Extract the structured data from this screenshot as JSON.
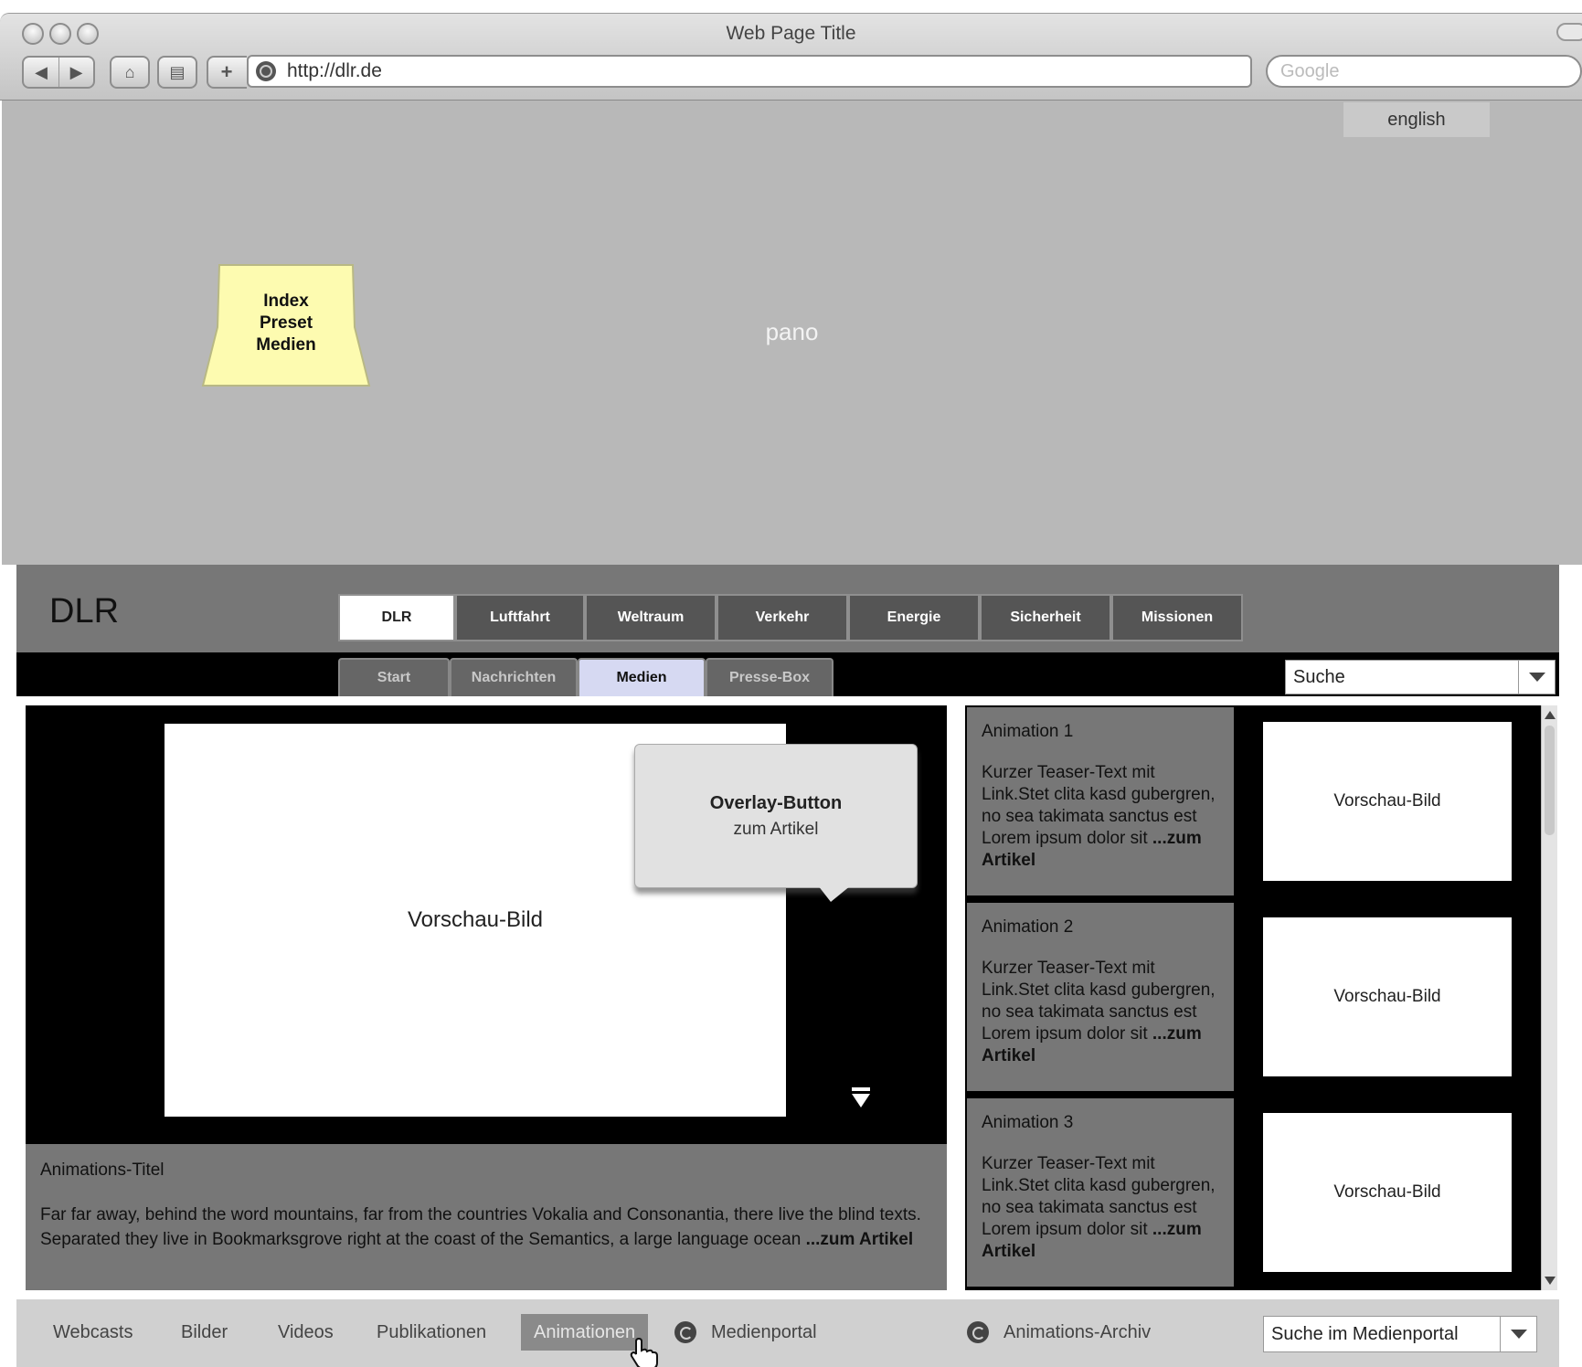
{
  "browser": {
    "window_title": "Web Page Title",
    "url": "http://dlr.de",
    "search_placeholder": "Google"
  },
  "header": {
    "language_label": "english",
    "pano_label": "pano",
    "sticky_note": [
      "Index",
      "Preset",
      "Medien"
    ]
  },
  "site": {
    "logo": "DLR",
    "main_tabs": [
      {
        "label": "DLR",
        "active": true
      },
      {
        "label": "Luftfahrt",
        "active": false
      },
      {
        "label": "Weltraum",
        "active": false
      },
      {
        "label": "Verkehr",
        "active": false
      },
      {
        "label": "Energie",
        "active": false
      },
      {
        "label": "Sicherheit",
        "active": false
      },
      {
        "label": "Missionen",
        "active": false
      }
    ],
    "sub_tabs": [
      {
        "label": "Start",
        "active": false
      },
      {
        "label": "Nachrichten",
        "active": false
      },
      {
        "label": "Medien",
        "active": true
      },
      {
        "label": "Presse-Box",
        "active": false
      }
    ],
    "search_select": "Suche"
  },
  "player": {
    "preview_label": "Vorschau-Bild",
    "overlay_title": "Overlay-Button",
    "overlay_subtitle": "zum Artikel",
    "caption_title": "Animations-Titel",
    "caption_text": "Far far away, behind the word mountains, far from the countries Vokalia and Consonantia, there live the blind texts. Separated they live in Bookmarksgrove right at the coast of the Semantics, a large language ocean",
    "caption_link": "...zum Artikel"
  },
  "animations": [
    {
      "title": "Animation 1",
      "text": "Kurzer Teaser-Text mit Link.Stet clita kasd gubergren, no sea takimata sanctus est Lorem ipsum dolor sit",
      "link": "...zum Artikel",
      "preview": "Vorschau-Bild"
    },
    {
      "title": "Animation 2",
      "text": "Kurzer Teaser-Text mit Link.Stet clita kasd gubergren, no sea takimata sanctus est Lorem ipsum dolor sit",
      "link": "...zum Artikel",
      "preview": "Vorschau-Bild"
    },
    {
      "title": "Animation 3",
      "text": "Kurzer Teaser-Text mit Link.Stet clita kasd gubergren, no sea takimata sanctus est Lorem ipsum dolor sit",
      "link": "...zum Artikel",
      "preview": "Vorschau-Bild"
    }
  ],
  "bottom_nav": {
    "items": [
      {
        "label": "Webcasts",
        "active": false
      },
      {
        "label": "Bilder",
        "active": false
      },
      {
        "label": "Videos",
        "active": false
      },
      {
        "label": "Publikationen",
        "active": false
      },
      {
        "label": "Animationen",
        "active": true
      }
    ],
    "medienportal": "Medienportal",
    "archive": "Animations-Archiv",
    "search_select": "Suche im Medienportal"
  },
  "colors": {
    "header_bg": "#b8b8b8",
    "dlr_bar": "#777777",
    "active_subtab": "#d6d9f2",
    "sticky_note": "#fdfbb0"
  }
}
